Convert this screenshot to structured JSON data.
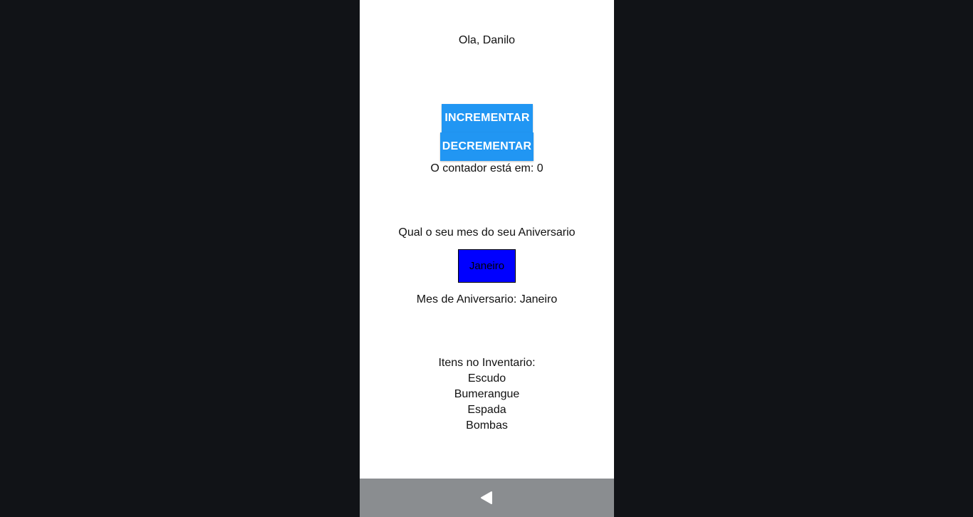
{
  "greeting": "Ola, Danilo",
  "counter": {
    "increment_label": "Incrementar",
    "decrement_label": "Decrementar",
    "status_text": "O contador está em: 0"
  },
  "birthday": {
    "question": "Qual o seu mes do seu Aniversario",
    "selected_month": "Janeiro",
    "result_text": "Mes de Aniversario: Janeiro",
    "box_color": "#0000FF"
  },
  "inventory": {
    "heading": "Itens no Inventario:",
    "items": [
      "Escudo",
      "Bumerangue",
      "Espada",
      "Bombas"
    ]
  },
  "navbar": {
    "back_icon": "back-triangle-icon"
  },
  "colors": {
    "button": "#2196F3",
    "backdrop": "#111317",
    "navbar": "#8a8d90"
  }
}
